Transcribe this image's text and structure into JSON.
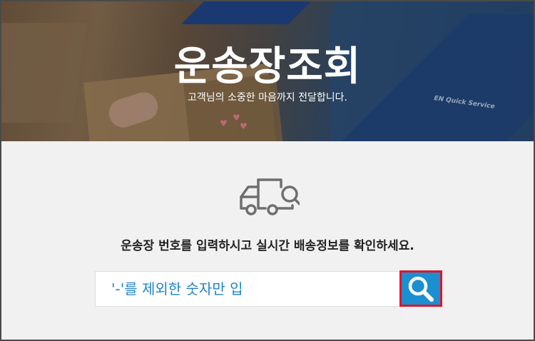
{
  "hero": {
    "title": "운송장조회",
    "subtitle": "고객님의 소중한 마음까지 전달합니다.",
    "shirt_text": "EN Quick Service"
  },
  "main": {
    "icon": "delivery-truck-search-icon",
    "instruction": "운송장 번호를 입력하시고 실시간 배송정보를 확인하세요.",
    "search": {
      "placeholder": "'-'를 제외한 숫자만 입",
      "value": ""
    },
    "search_button_icon": "search-icon"
  },
  "colors": {
    "accent_blue": "#1b8fcf",
    "highlight_red": "#e0142a",
    "placeholder_blue": "#1f84c6",
    "background_gray": "#f1f1f1"
  }
}
